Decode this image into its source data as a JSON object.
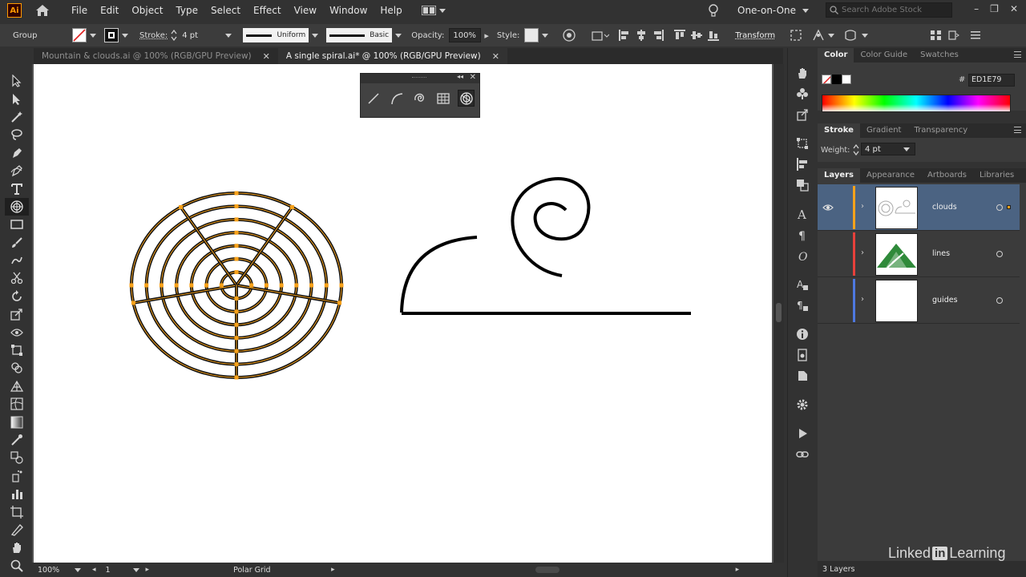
{
  "app": {
    "logo_text": "Ai"
  },
  "menu": [
    "File",
    "Edit",
    "Object",
    "Type",
    "Select",
    "Effect",
    "View",
    "Window",
    "Help"
  ],
  "workspace": {
    "label": "One-on-One"
  },
  "search": {
    "placeholder": "Search Adobe Stock"
  },
  "control_bar": {
    "selection_type": "Group",
    "stroke_label": "Stroke:",
    "stroke_weight": "4 pt",
    "variable_width_profile": "Uniform",
    "brush": "Basic",
    "opacity_label": "Opacity:",
    "opacity_value": "100%",
    "style_label": "Style:",
    "transform_label": "Transform"
  },
  "tabs": [
    {
      "label": "Mountain & clouds.ai @ 100% (RGB/GPU Preview)",
      "active": false
    },
    {
      "label": "A single spiral.ai* @ 100% (RGB/GPU Preview)",
      "active": true
    }
  ],
  "tools": [
    "selection-tool",
    "direct-selection-tool",
    "magic-wand-tool",
    "lasso-tool",
    "pen-tool",
    "curvature-tool",
    "type-tool",
    "polar-grid-tool",
    "rectangle-tool",
    "paintbrush-tool",
    "shaper-tool",
    "scissors-tool",
    "rotate-tool",
    "scale-tool",
    "width-tool",
    "free-transform-tool",
    "shape-builder-tool",
    "perspective-grid-tool",
    "mesh-tool",
    "gradient-tool",
    "eyedropper-tool",
    "blend-tool",
    "symbol-sprayer-tool",
    "column-graph-tool",
    "artboard-tool",
    "slice-tool",
    "hand-tool",
    "zoom-tool"
  ],
  "line_tools_panel": [
    "line-segment-icon",
    "arc-icon",
    "spiral-icon",
    "rectangular-grid-icon",
    "polar-grid-icon"
  ],
  "status": {
    "zoom": "100%",
    "artboard": "1",
    "current_tool": "Polar Grid"
  },
  "color_panel": {
    "tabs": [
      "Color",
      "Color Guide",
      "Swatches"
    ],
    "hex_symbol": "#",
    "hex": "ED1E79"
  },
  "stroke_panel": {
    "tabs": [
      "Stroke",
      "Gradient",
      "Transparency"
    ],
    "weight_label": "Weight:",
    "weight_value": "4 pt"
  },
  "layers_panel": {
    "tabs": [
      "Layers",
      "Appearance",
      "Artboards",
      "Libraries"
    ],
    "layers": [
      {
        "name": "clouds",
        "color": "#f7a21b",
        "selected": true
      },
      {
        "name": "lines",
        "color": "#e8413b",
        "selected": false
      },
      {
        "name": "guides",
        "color": "#4e78e0",
        "selected": false
      }
    ],
    "count_text": "3 Layers"
  },
  "watermark": {
    "pre": "Linked",
    "in": "in",
    "post": " Learning"
  },
  "colors": {
    "selection": "#f7a21b",
    "layer_selected": "#4b6382"
  }
}
